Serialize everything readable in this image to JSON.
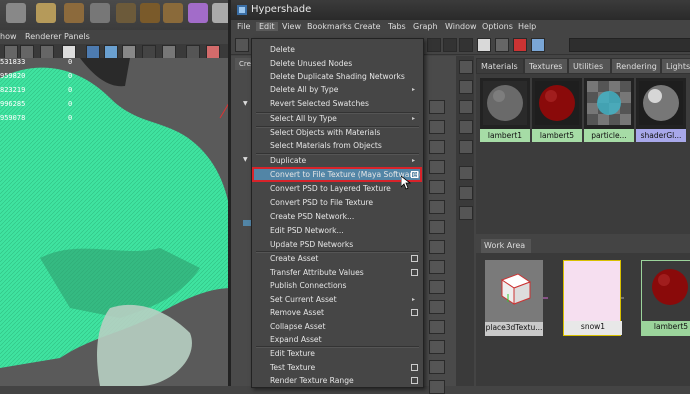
{
  "maya": {
    "menubar": [
      "how",
      "Renderer",
      "Panels"
    ],
    "hud_values": [
      "531833",
      "959820",
      "823219",
      "996285",
      "959078"
    ],
    "hud_zero": "0"
  },
  "hypershade": {
    "title": "Hypershade",
    "menubar": [
      "File",
      "Edit",
      "View",
      "Bookmarks",
      "Create",
      "Tabs",
      "Graph",
      "Window",
      "Options",
      "Help"
    ],
    "left_tab": "Cre",
    "material_tabs": [
      "Materials",
      "Textures",
      "Utilities",
      "Rendering",
      "Lights"
    ],
    "swatches": [
      {
        "label": "lambert1"
      },
      {
        "label": "lambert5"
      },
      {
        "label": "particle..."
      },
      {
        "label": "shaderGl..."
      }
    ],
    "work_area_tab": "Work Area",
    "nodes": [
      {
        "label": "place3dTextu..."
      },
      {
        "label": "snow1"
      },
      {
        "label": "lambert5"
      }
    ]
  },
  "edit_menu": {
    "items": [
      {
        "label": "Delete"
      },
      {
        "label": "Delete Unused Nodes"
      },
      {
        "label": "Delete Duplicate Shading Networks"
      },
      {
        "label": "Delete All by Type",
        "submenu": true
      },
      {
        "label": "Revert Selected Swatches"
      },
      {
        "label": "Select All by Type",
        "submenu": true
      },
      {
        "label": "Select Objects with Materials"
      },
      {
        "label": "Select Materials from Objects"
      },
      {
        "label": "Duplicate",
        "submenu": true
      },
      {
        "label": "Convert to File Texture (Maya Software)",
        "option": true,
        "highlighted": true
      },
      {
        "label": "Convert PSD to Layered Texture"
      },
      {
        "label": "Convert PSD to File Texture"
      },
      {
        "label": "Create PSD Network..."
      },
      {
        "label": "Edit PSD Network..."
      },
      {
        "label": "Update PSD Networks"
      },
      {
        "label": "Create Asset",
        "option": true
      },
      {
        "label": "Transfer Attribute Values",
        "option": true
      },
      {
        "label": "Publish Connections"
      },
      {
        "label": "Set Current Asset",
        "submenu": true
      },
      {
        "label": "Remove Asset",
        "option": true
      },
      {
        "label": "Collapse Asset"
      },
      {
        "label": "Expand Asset"
      },
      {
        "label": "Edit Texture"
      },
      {
        "label": "Test Texture",
        "option": true
      },
      {
        "label": "Render Texture Range",
        "option": true
      }
    ]
  },
  "colors": {
    "highlight": "#5285a6",
    "highlight_border": "#d8232a",
    "mesh": "#4ee8a6",
    "node_green": "#9bd49b",
    "node_pink": "#f6dff0"
  }
}
